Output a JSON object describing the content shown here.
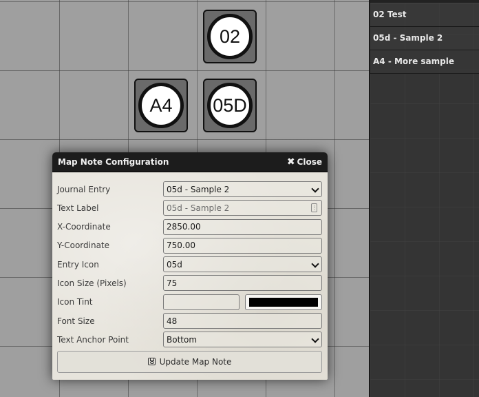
{
  "map_notes": [
    {
      "label": "02"
    },
    {
      "label": "A4"
    },
    {
      "label": "05D"
    }
  ],
  "sidebar": {
    "entries": [
      {
        "label": "02 Test"
      },
      {
        "label": "05d - Sample 2"
      },
      {
        "label": "A4 - More sample"
      }
    ]
  },
  "dialog": {
    "title": "Map Note Configuration",
    "close_label": "Close",
    "close_icon": "close-icon",
    "fields": {
      "journal_entry": {
        "label": "Journal Entry",
        "value": "05d - Sample 2"
      },
      "text_label": {
        "label": "Text Label",
        "placeholder": "05d - Sample 2"
      },
      "x_coordinate": {
        "label": "X-Coordinate",
        "value": "2850.00"
      },
      "y_coordinate": {
        "label": "Y-Coordinate",
        "value": "750.00"
      },
      "entry_icon": {
        "label": "Entry Icon",
        "value": "05d"
      },
      "icon_size": {
        "label": "Icon Size (Pixels)",
        "value": "75"
      },
      "icon_tint": {
        "label": "Icon Tint",
        "value": "",
        "color": "#000000"
      },
      "font_size": {
        "label": "Font Size",
        "value": "48"
      },
      "text_anchor": {
        "label": "Text Anchor Point",
        "value": "Bottom"
      }
    },
    "submit_label": "Update Map Note",
    "submit_icon": "save-icon"
  }
}
